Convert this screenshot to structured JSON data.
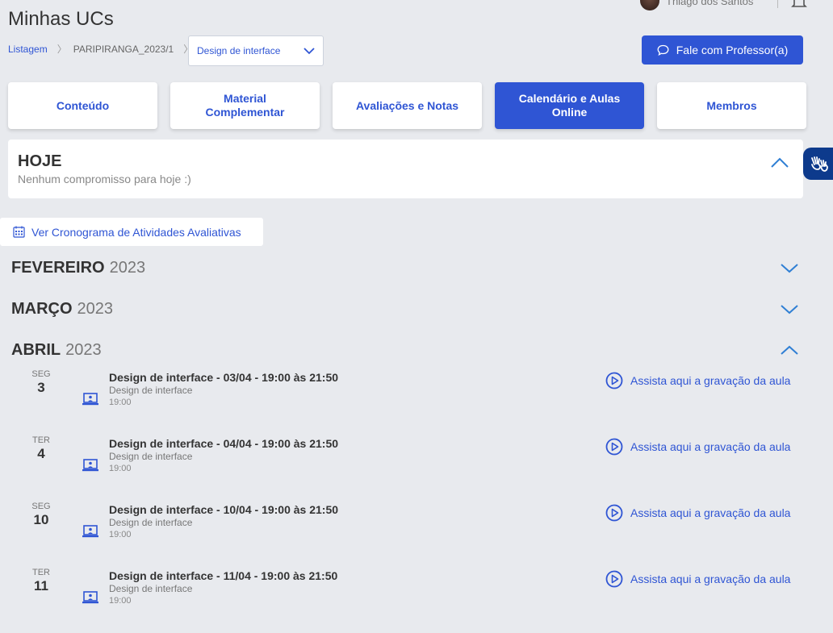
{
  "header": {
    "title": "Minhas UCs",
    "user_name": "Thiago dos Santos"
  },
  "breadcrumb": {
    "listing": "Listagem",
    "term": "PARIPIRANGA_2023/1",
    "uc_selected": "Design de interface"
  },
  "contact_button": "Fale com Professor(a)",
  "tabs": [
    {
      "label": "Conteúdo"
    },
    {
      "label": "Material Complementar"
    },
    {
      "label": "Avaliações e Notas"
    },
    {
      "label": "Calendário e Aulas Online"
    },
    {
      "label": "Membros"
    }
  ],
  "active_tab": "Calendário e Aulas Online",
  "today": {
    "title": "HOJE",
    "message": "Nenhum compromisso para hoje :)"
  },
  "schedule_button": "Ver Cronograma de Atividades Avaliativas",
  "months": [
    {
      "name": "FEVEREIRO",
      "year": "2023",
      "expanded": false
    },
    {
      "name": "MARÇO",
      "year": "2023",
      "expanded": false
    },
    {
      "name": "ABRIL",
      "year": "2023",
      "expanded": true
    }
  ],
  "events": [
    {
      "dow": "SEG",
      "day": "3",
      "title": "Design de interface - 03/04 - 19:00 às 21:50",
      "subject": "Design de interface",
      "time": "19:00",
      "recording_label": "Assista aqui a gravação da aula"
    },
    {
      "dow": "TER",
      "day": "4",
      "title": "Design de interface - 04/04 - 19:00 às 21:50",
      "subject": "Design de interface",
      "time": "19:00",
      "recording_label": "Assista aqui a gravação da aula"
    },
    {
      "dow": "SEG",
      "day": "10",
      "title": "Design de interface - 10/04 - 19:00 às 21:50",
      "subject": "Design de interface",
      "time": "19:00",
      "recording_label": "Assista aqui a gravação da aula"
    },
    {
      "dow": "TER",
      "day": "11",
      "title": "Design de interface - 11/04 - 19:00 às 21:50",
      "subject": "Design de interface",
      "time": "19:00",
      "recording_label": "Assista aqui a gravação da aula"
    }
  ],
  "colors": {
    "primary": "#2f55d4",
    "background": "#e8eaee",
    "accessibility_tab": "#0d3a8c"
  },
  "icons": {
    "chat": "chat-bubble-icon",
    "calendar": "calendar-icon",
    "event": "laptop-icon",
    "play": "play-circle-icon",
    "accessibility": "sign-language-hands-icon",
    "bell": "bell-icon"
  }
}
